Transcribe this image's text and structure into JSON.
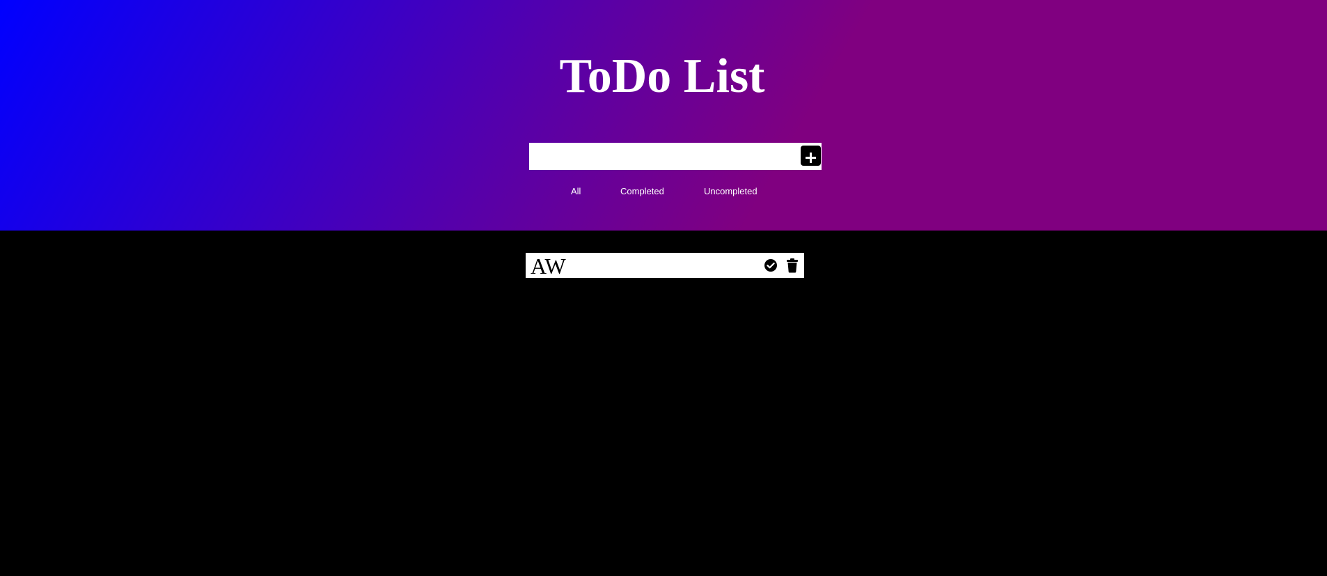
{
  "header": {
    "title": "ToDo List",
    "background_gradient": [
      "#0000ff",
      "#800080"
    ]
  },
  "input": {
    "value": "",
    "placeholder": "",
    "add_icon": "plus-square-icon"
  },
  "filters": [
    {
      "label": "All",
      "selected": true
    },
    {
      "label": "Completed",
      "selected": false
    },
    {
      "label": "Uncompleted",
      "selected": false
    }
  ],
  "todos": [
    {
      "text": "AW",
      "complete_icon": "check-circle-icon",
      "delete_icon": "trash-icon"
    }
  ],
  "colors": {
    "page_background": "#000000",
    "text_on_header": "#ffffff",
    "item_background": "#ffffff"
  }
}
